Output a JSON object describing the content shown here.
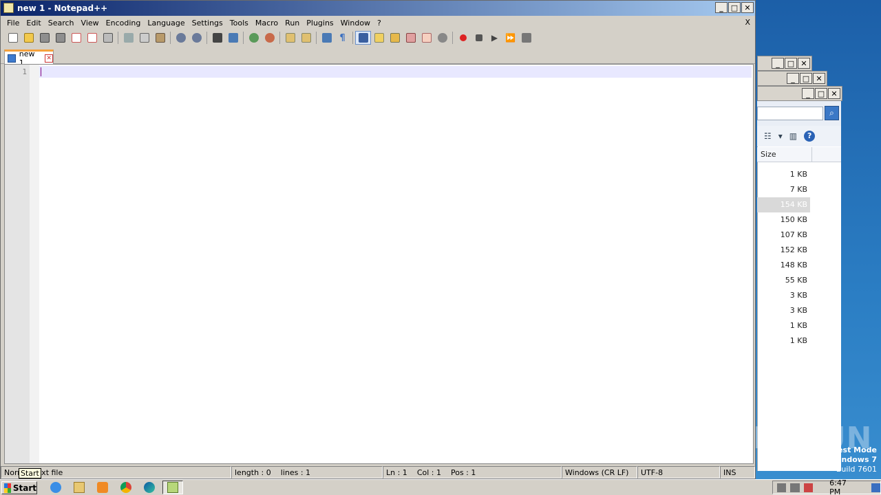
{
  "notepad": {
    "title": "new 1 - Notepad++",
    "menu": [
      "File",
      "Edit",
      "Search",
      "View",
      "Encoding",
      "Language",
      "Settings",
      "Tools",
      "Macro",
      "Run",
      "Plugins",
      "Window",
      "?"
    ],
    "menu_close": "X",
    "tab_label": "new 1",
    "line_number": "1",
    "status": {
      "file_type": "Normal text file",
      "length": "length : 0",
      "lines": "lines : 1",
      "ln": "Ln : 1",
      "col": "Col : 1",
      "pos": "Pos : 1",
      "eol": "Windows (CR LF)",
      "encoding": "UTF-8",
      "mode": "INS"
    }
  },
  "tooltip": "Start",
  "explorer": {
    "column_size": "Size",
    "sizes": [
      "1 KB",
      "7 KB",
      "154 KB",
      "150 KB",
      "107 KB",
      "152 KB",
      "148 KB",
      "55 KB",
      "3 KB",
      "3 KB",
      "1 KB",
      "1 KB"
    ],
    "selected_index": 2
  },
  "desktop": {
    "test_mode_line1": "est Mode",
    "test_mode_line2": "indows 7",
    "build": "Build 7601",
    "watermark": "ANY RUN"
  },
  "taskbar": {
    "start_label": "Start",
    "icons": [
      "ie-icon",
      "explorer-icon",
      "media-player-icon",
      "chrome-icon",
      "edge-icon",
      "notepadpp-icon"
    ],
    "clock": "6:47 PM"
  },
  "colors": {
    "title_start": "#0a246a",
    "title_end": "#a6caf0",
    "current_line": "#e8e8ff",
    "tab_accent": "#f5a13c"
  }
}
